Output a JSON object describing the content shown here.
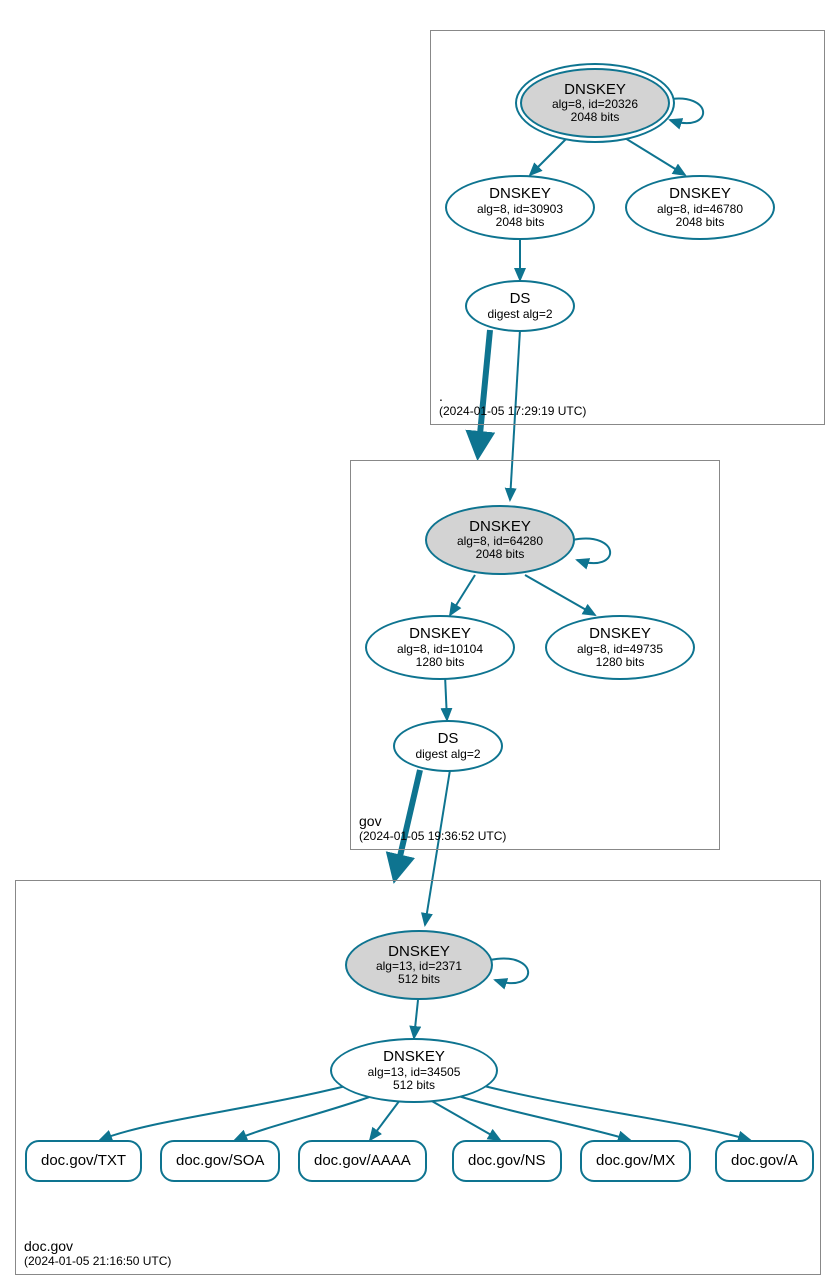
{
  "zones": {
    "root": {
      "name": ".",
      "timestamp": "(2024-01-05 17:29:19 UTC)",
      "nodes": {
        "ksk": {
          "title": "DNSKEY",
          "line2": "alg=8, id=20326",
          "line3": "2048 bits"
        },
        "zsk1": {
          "title": "DNSKEY",
          "line2": "alg=8, id=30903",
          "line3": "2048 bits"
        },
        "zsk2": {
          "title": "DNSKEY",
          "line2": "alg=8, id=46780",
          "line3": "2048 bits"
        },
        "ds": {
          "title": "DS",
          "line2": "digest alg=2"
        }
      }
    },
    "gov": {
      "name": "gov",
      "timestamp": "(2024-01-05 19:36:52 UTC)",
      "nodes": {
        "ksk": {
          "title": "DNSKEY",
          "line2": "alg=8, id=64280",
          "line3": "2048 bits"
        },
        "zsk1": {
          "title": "DNSKEY",
          "line2": "alg=8, id=10104",
          "line3": "1280 bits"
        },
        "zsk2": {
          "title": "DNSKEY",
          "line2": "alg=8, id=49735",
          "line3": "1280 bits"
        },
        "ds": {
          "title": "DS",
          "line2": "digest alg=2"
        }
      }
    },
    "docgov": {
      "name": "doc.gov",
      "timestamp": "(2024-01-05 21:16:50 UTC)",
      "nodes": {
        "ksk": {
          "title": "DNSKEY",
          "line2": "alg=13, id=2371",
          "line3": "512 bits"
        },
        "zsk": {
          "title": "DNSKEY",
          "line2": "alg=13, id=34505",
          "line3": "512 bits"
        }
      },
      "records": {
        "txt": "doc.gov/TXT",
        "soa": "doc.gov/SOA",
        "aaaa": "doc.gov/AAAA",
        "ns": "doc.gov/NS",
        "mx": "doc.gov/MX",
        "a": "doc.gov/A"
      }
    }
  }
}
